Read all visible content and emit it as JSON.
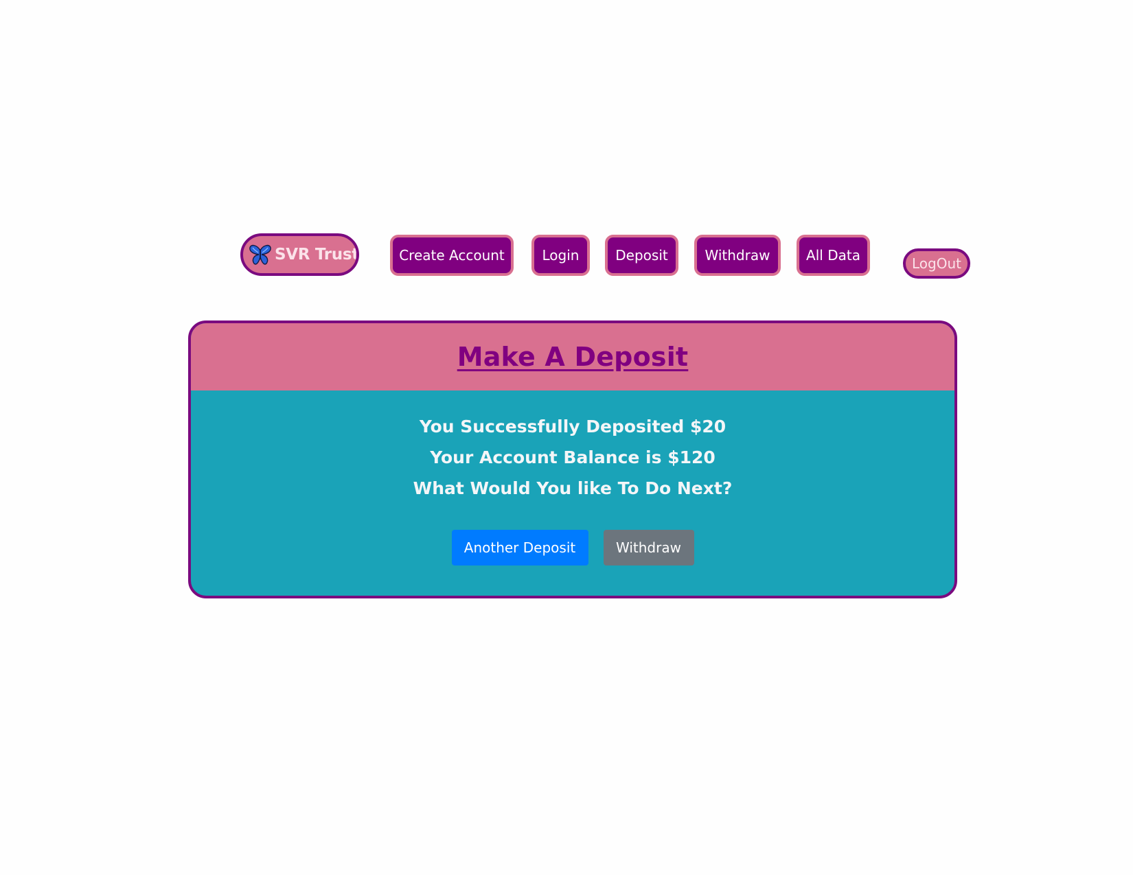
{
  "navbar": {
    "brand": {
      "icon": "butterfly-icon",
      "label": "SVR Trust"
    },
    "items": [
      {
        "label": "Create Account"
      },
      {
        "label": "Login"
      },
      {
        "label": "Deposit"
      },
      {
        "label": "Withdraw"
      },
      {
        "label": "All Data"
      }
    ],
    "logout_label": "LogOut"
  },
  "card": {
    "title": "Make A Deposit",
    "messages": [
      "You Successfully Deposited $20",
      "Your Account Balance is $120",
      "What Would You like To Do Next?"
    ],
    "primary_button": "Another Deposit",
    "secondary_button": "Withdraw"
  },
  "colors": {
    "purple": "#800080",
    "pink": "#d97090",
    "teal": "#1aa3b8",
    "primary_blue": "#007bff",
    "secondary_gray": "#6c757d"
  }
}
